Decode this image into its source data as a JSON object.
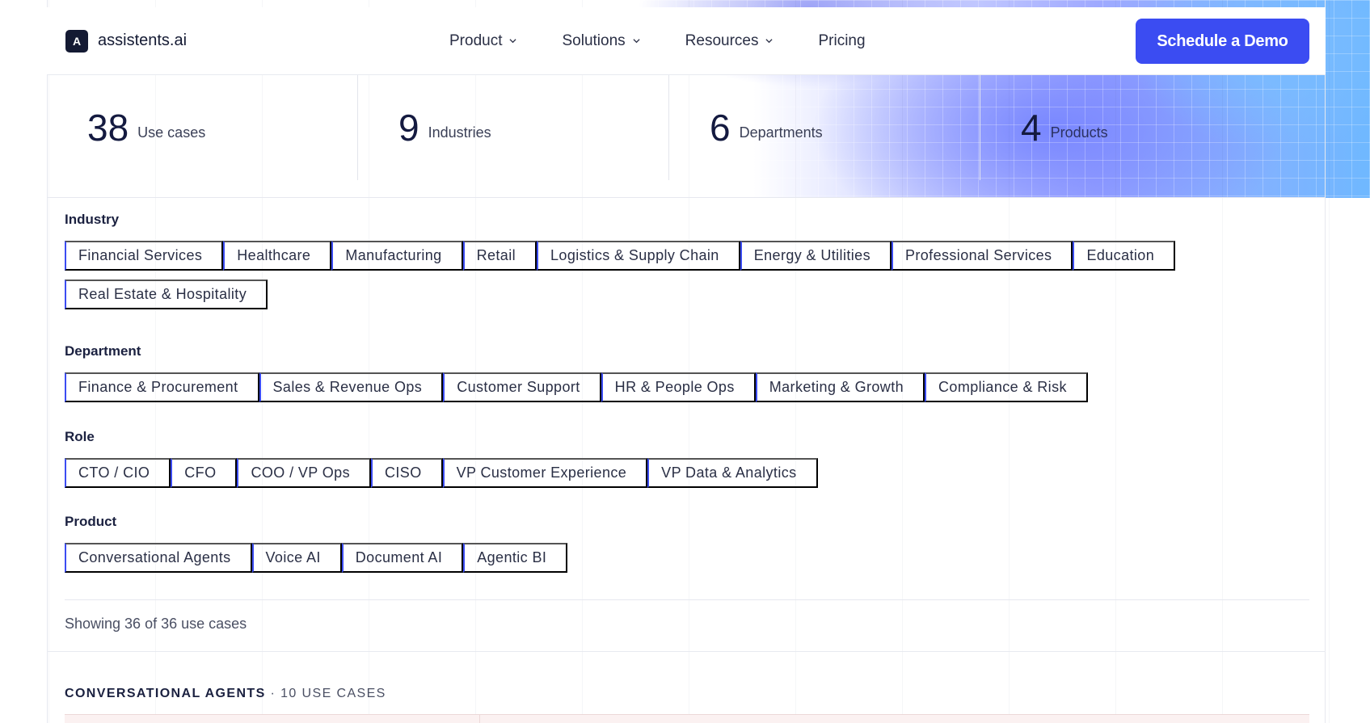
{
  "brand": {
    "mark": "A",
    "name": "assistents.ai"
  },
  "nav": {
    "items": [
      {
        "label": "Product",
        "dropdown": true
      },
      {
        "label": "Solutions",
        "dropdown": true
      },
      {
        "label": "Resources",
        "dropdown": true
      },
      {
        "label": "Pricing",
        "dropdown": false
      }
    ],
    "cta": "Schedule a Demo"
  },
  "stats": [
    {
      "value": "38",
      "label": "Use cases"
    },
    {
      "value": "9",
      "label": "Industries"
    },
    {
      "value": "6",
      "label": "Departments"
    },
    {
      "value": "4",
      "label": "Products"
    }
  ],
  "filters": {
    "industry": {
      "title": "Industry",
      "options": [
        "Financial Services",
        "Healthcare",
        "Manufacturing",
        "Retail",
        "Logistics & Supply Chain",
        "Energy & Utilities",
        "Professional Services",
        "Education",
        "Real Estate & Hospitality"
      ]
    },
    "department": {
      "title": "Department",
      "options": [
        "Finance & Procurement",
        "Sales & Revenue Ops",
        "Customer Support",
        "HR & People Ops",
        "Marketing & Growth",
        "Compliance & Risk"
      ]
    },
    "role": {
      "title": "Role",
      "options": [
        "CTO / CIO",
        "CFO",
        "COO / VP Ops",
        "CISO",
        "VP Customer Experience",
        "VP Data & Analytics"
      ]
    },
    "product": {
      "title": "Product",
      "options": [
        "Conversational Agents",
        "Voice AI",
        "Document AI",
        "Agentic BI"
      ]
    }
  },
  "results": {
    "showing": "Showing 36 of 36 use cases"
  },
  "section": {
    "name": "CONVERSATIONAL AGENTS",
    "separator": " · ",
    "count": "10 USE CASES"
  },
  "colors": {
    "accent": "#3b4cf2",
    "ink": "#141a40"
  }
}
